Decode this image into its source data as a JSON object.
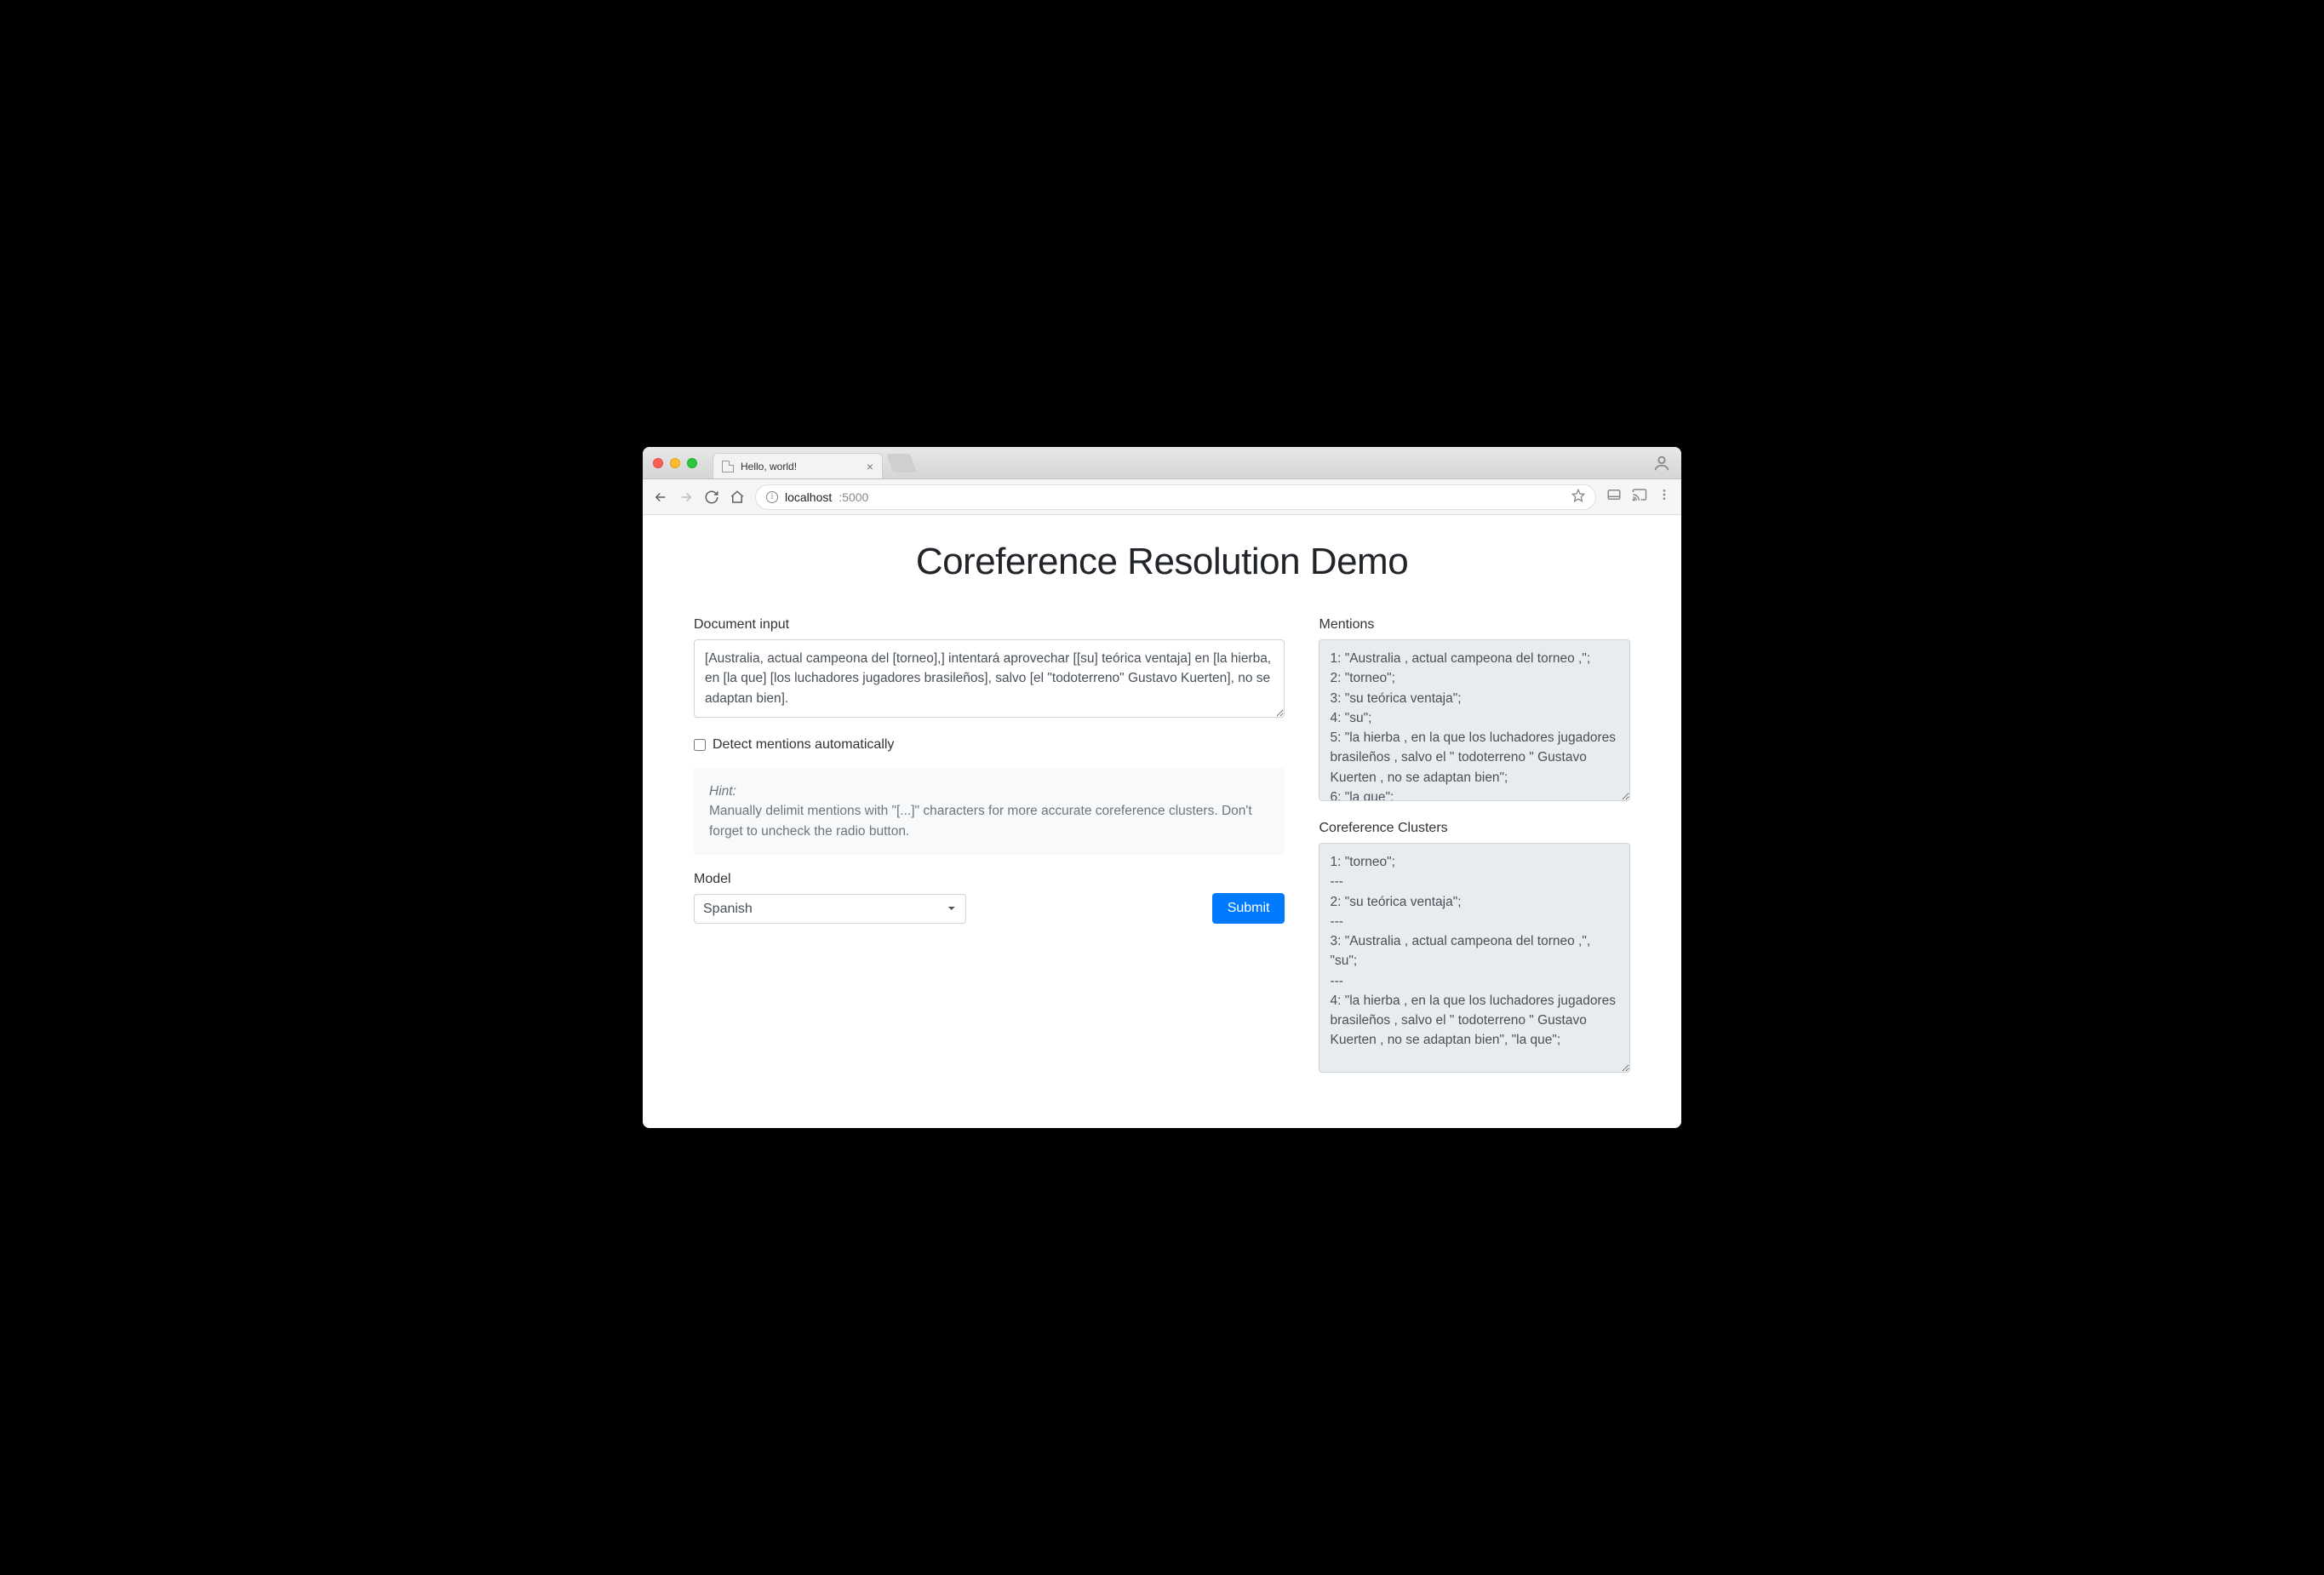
{
  "browser": {
    "tab_title": "Hello, world!",
    "url_host": "localhost",
    "url_port": ":5000"
  },
  "page": {
    "title": "Coreference Resolution Demo"
  },
  "left": {
    "doc_label": "Document input",
    "doc_value": "[Australia, actual campeona del [torneo],] intentará aprovechar [[su] teórica ventaja] en [la hierba, en [la que] [los luchadores jugadores brasileños], salvo [el \"todoterreno\" Gustavo Kuerten], no se adaptan bien].",
    "detect_label": "Detect mentions automatically",
    "detect_checked": false,
    "hint_heading": "Hint:",
    "hint_body": "Manually delimit mentions with \"[...]\" characters for more accurate coreference clusters. Don't forget to uncheck the radio button.",
    "model_label": "Model",
    "model_selected": "Spanish",
    "submit_label": "Submit"
  },
  "right": {
    "mentions_label": "Mentions",
    "mentions_value": "1: \"Australia , actual campeona del torneo ,\";\n2: \"torneo\";\n3: \"su teórica ventaja\";\n4: \"su\";\n5: \"la hierba , en la que los luchadores jugadores brasileños , salvo el \" todoterreno \" Gustavo Kuerten , no se adaptan bien\";\n6: \"la que\";",
    "clusters_label": "Coreference Clusters",
    "clusters_value": "1: \"torneo\";\n---\n2: \"su teórica ventaja\";\n---\n3: \"Australia , actual campeona del torneo ,\", \"su\";\n---\n4: \"la hierba , en la que los luchadores jugadores brasileños , salvo el \" todoterreno \" Gustavo Kuerten , no se adaptan bien\", \"la que\";"
  }
}
